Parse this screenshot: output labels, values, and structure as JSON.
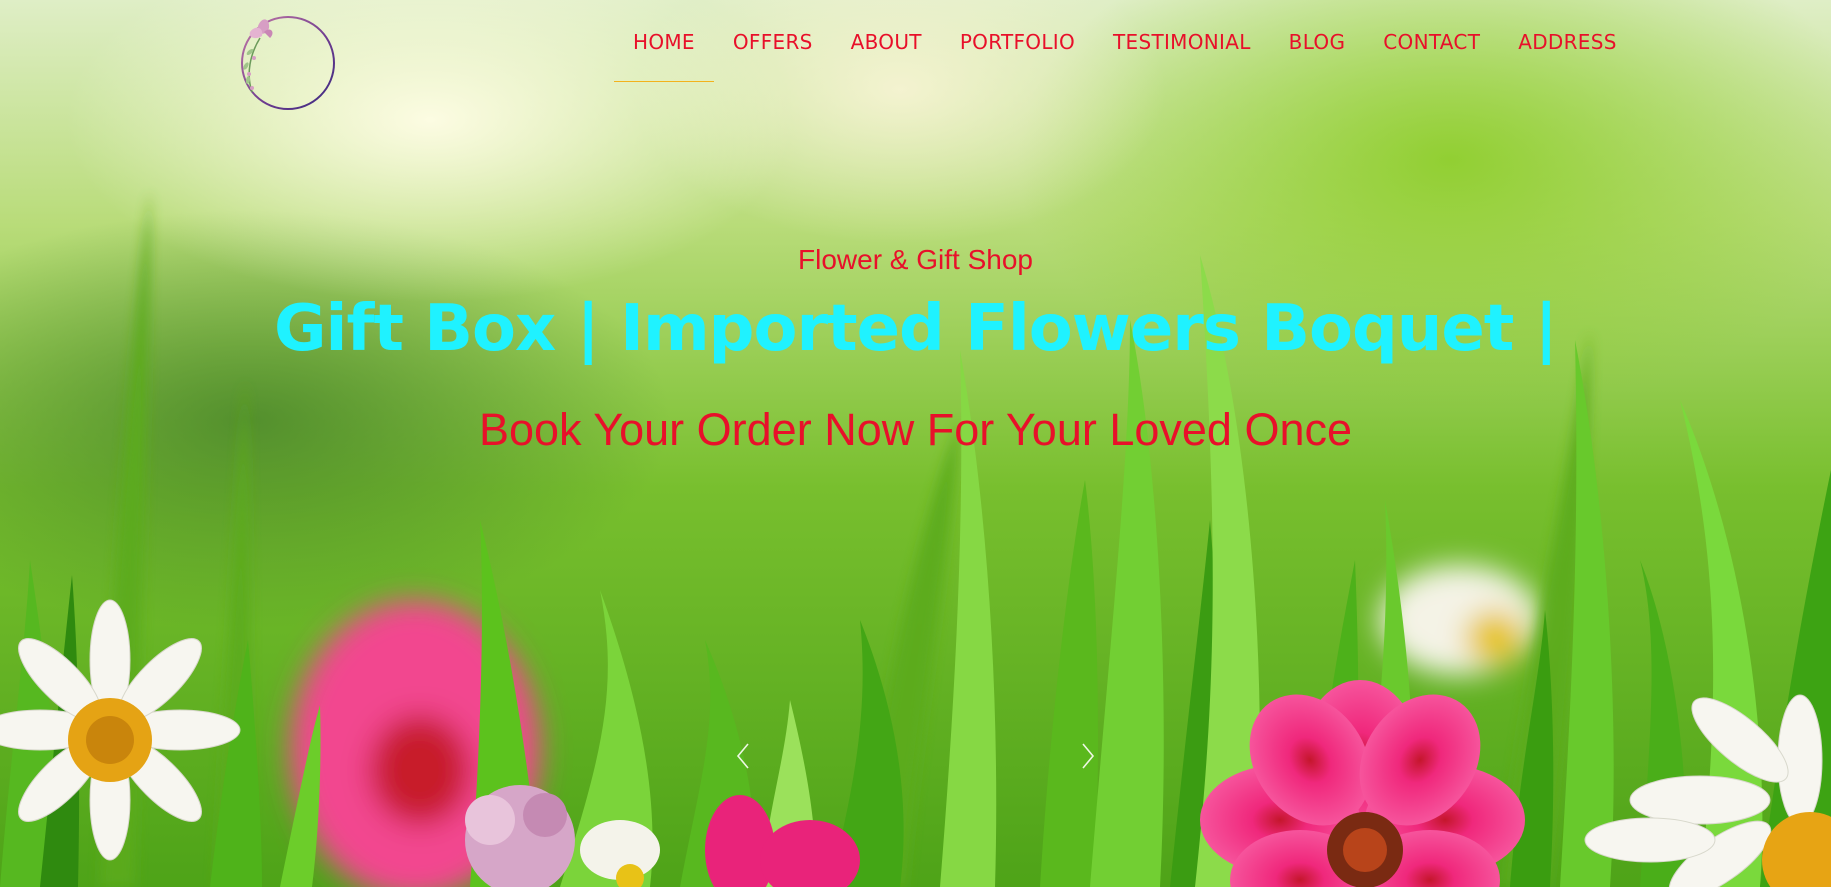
{
  "nav": {
    "items": [
      {
        "label": "HOME",
        "active": true
      },
      {
        "label": "OFFERS"
      },
      {
        "label": "ABOUT"
      },
      {
        "label": "PORTFOLIO"
      },
      {
        "label": "TESTIMONIAL"
      },
      {
        "label": "BLOG"
      },
      {
        "label": "CONTACT"
      },
      {
        "label": "ADDRESS"
      }
    ],
    "link_color": "#e8102a",
    "active_underline_color": "#f3b21c"
  },
  "hero": {
    "subtitle": "Flower & Gift Shop",
    "headline": "Gift Box | Imported Flowers Boquet |",
    "tagline": "Book Your Order Now For Your Loved Once",
    "headline_color": "#1ff2ff",
    "text_color": "#e8102a",
    "prev_icon": "chevron-left-icon",
    "next_icon": "chevron-right-icon"
  },
  "logo": {
    "icon": "floral-wreath-logo-icon"
  }
}
